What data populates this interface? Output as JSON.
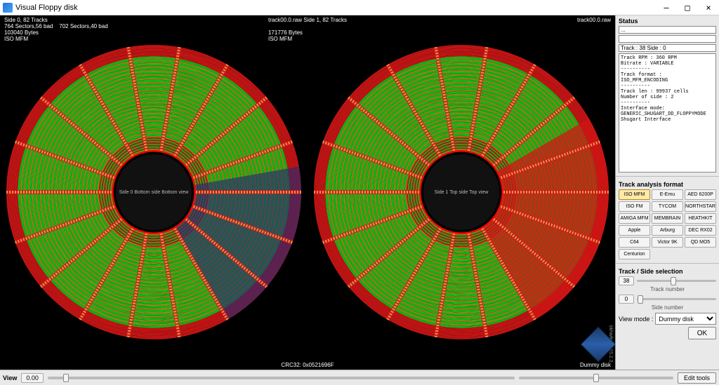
{
  "window": {
    "title": "Visual Floppy disk",
    "minimize": "–",
    "maximize": "□",
    "close": "×"
  },
  "vis": {
    "left_info": "Side 0, 82 Tracks\n764 Sectors,56 bad    702 Sectors,40 bad\n103040 Bytes\nISO MFM",
    "center_info": "track00.0.raw Side 1, 82 Tracks\n\n171776 Bytes\nISO MFM",
    "right_info": "track00.0.raw",
    "disk0_label": "Side 0\nBottom side\nBottom view",
    "disk1_label": "Side 1\nTop side\nTop view",
    "crc": "CRC32: 0x0521696F",
    "dummy": "Dummy disk",
    "version": "tikhwfe v2.15.2.3"
  },
  "status": {
    "head": "Status",
    "line1": "...",
    "line2": "",
    "trackside": "Track : 38 Side : 0",
    "info": "Track RPM : 360 RPM\nBitrate : VARIABLE\n----------\nTrack format :\nISO_MFM_ENCODING\n----------\nTrack len : 99937 cells\nNumber of side : 2\n----------\nInterface mode:\nGENERIC_SHUGART_DD_FLOPPYMODE\nShugart Interface"
  },
  "formats": {
    "head": "Track analysis format",
    "items": [
      "ISO MFM",
      "E-Emu",
      "AED 6200P",
      "ISO FM",
      "TYCOM",
      "NORTHSTAR",
      "AMIGA MFM",
      "MEMBRAIN",
      "HEATHKIT",
      "Apple",
      "Arburg",
      "DEC RX02",
      "C64",
      "Victor 9K",
      "QD MO5",
      "Centurion"
    ]
  },
  "selection": {
    "head": "Track / Side selection",
    "track_value": "38",
    "track_label": "Track number",
    "side_value": "0",
    "side_label": "Side number"
  },
  "viewmode": {
    "label": "View mode :",
    "selected": "Dummy disk"
  },
  "ok": "OK",
  "bottom": {
    "view_label": "View",
    "num": "0.00",
    "edit": "Edit tools"
  },
  "colors": {
    "track_good": "#18c219",
    "track_bad": "#d01616",
    "track_alt": "#c27f18",
    "sector_mark": "#2a2a70",
    "accent_ring": "#ff0202"
  }
}
